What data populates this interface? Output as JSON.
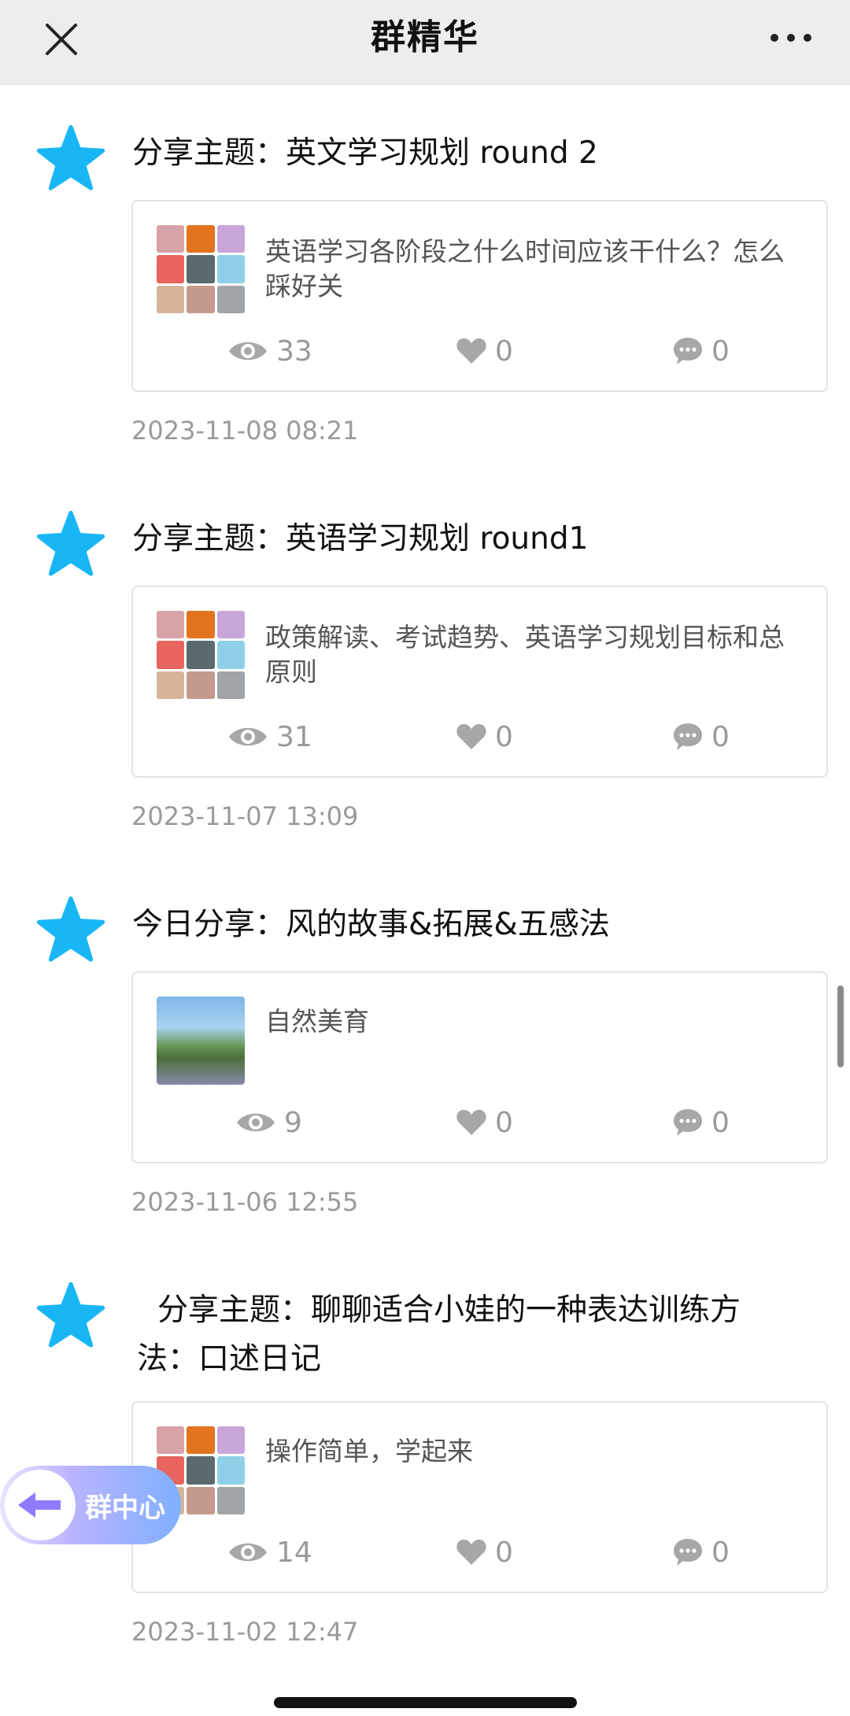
{
  "header": {
    "title": "群精华",
    "close_icon": "close-icon",
    "more_icon": "more-dots-icon"
  },
  "posts": [
    {
      "title": "分享主题：英文学习规划 round 2",
      "summary": "英语学习各阶段之什么时间应该干什么？怎么踩好关",
      "views": "33",
      "likes": "0",
      "comments": "0",
      "date": "2023-11-08 08:21",
      "thumb": "avatar-collage"
    },
    {
      "title": "分享主题：英语学习规划 round1",
      "summary": "政策解读、考试趋势、英语学习规划目标和总原则",
      "views": "31",
      "likes": "0",
      "comments": "0",
      "date": "2023-11-07 13:09",
      "thumb": "avatar-collage"
    },
    {
      "title": "今日分享：风的故事&拓展&五感法",
      "summary": "自然美育",
      "views": "9",
      "likes": "0",
      "comments": "0",
      "date": "2023-11-06 12:55",
      "thumb": "photo"
    },
    {
      "title": "分享主题：聊聊适合小娃的一种表达训练方法：口述日记",
      "summary": "操作简单，学起来",
      "views": "14",
      "likes": "0",
      "comments": "0",
      "date": "2023-11-02 12:47",
      "thumb": "avatar-collage"
    }
  ],
  "group_center_button": {
    "label": "群中心"
  },
  "colors": {
    "star": "#19b6f5",
    "topbar": "#ededed",
    "stat": "#9a9a9a"
  }
}
